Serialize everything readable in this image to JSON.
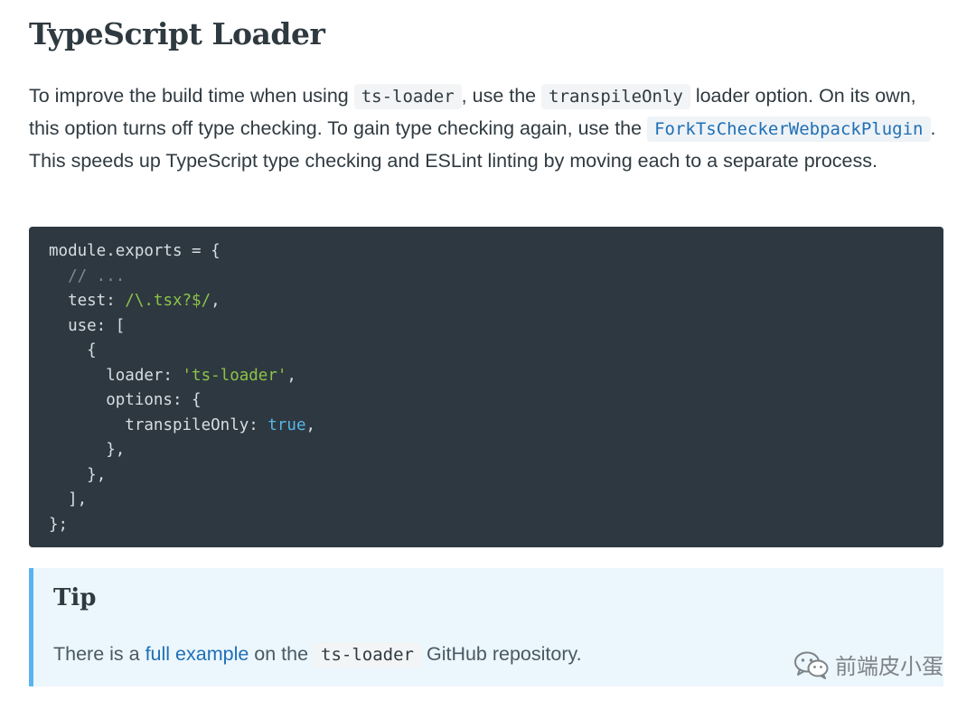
{
  "page": {
    "title": "TypeScript Loader"
  },
  "intro": {
    "part1": "To improve the build time when using ",
    "code1": "ts-loader",
    "part2": ", use the ",
    "code2": "transpileOnly",
    "part3": " loader option. On its own, this option turns off type checking. To gain type checking again, use the ",
    "code3": "ForkTsCheckerWebpackPlugin",
    "part4": ". This speeds up TypeScript type checking and ESLint linting by moving each to a separate process."
  },
  "code": {
    "l1": "module.exports = {",
    "l2_comment": "// ...",
    "l3_key": "test: ",
    "l3_regex": "/\\.tsx?$/",
    "l3_end": ",",
    "l4": "use: [",
    "l5": "{",
    "l6_key": "loader: ",
    "l6_string": "'ts-loader'",
    "l6_end": ",",
    "l7": "options: {",
    "l8_key": "transpileOnly: ",
    "l8_bool": "true",
    "l8_end": ",",
    "l9": "},",
    "l10": "},",
    "l11": "],",
    "l12": "};"
  },
  "tip": {
    "title": "Tip",
    "part1": "There is a ",
    "link": "full example",
    "part2": " on the ",
    "code": "ts-loader",
    "part3": " GitHub repository."
  },
  "watermark": {
    "icon": "wechat-icon",
    "text": "前端皮小蛋"
  },
  "colors": {
    "code_bg": "#2e3840",
    "tip_bg": "#ebf6fd",
    "tip_border": "#5ab3f0",
    "link": "#1f6fb5",
    "string_green": "#8bc34a",
    "bool_blue": "#56b6e8"
  }
}
